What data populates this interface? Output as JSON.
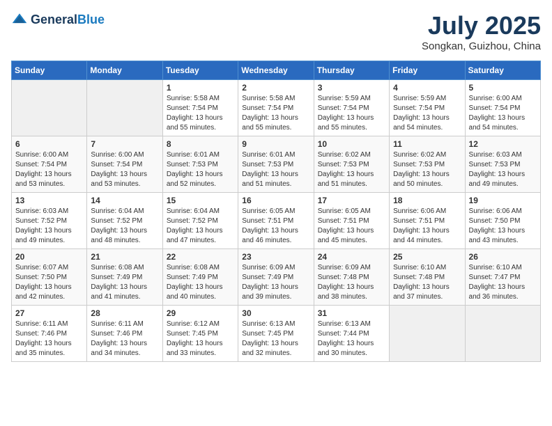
{
  "header": {
    "logo_general": "General",
    "logo_blue": "Blue",
    "month_title": "July 2025",
    "location": "Songkan, Guizhou, China"
  },
  "weekdays": [
    "Sunday",
    "Monday",
    "Tuesday",
    "Wednesday",
    "Thursday",
    "Friday",
    "Saturday"
  ],
  "weeks": [
    [
      {
        "day": "",
        "sunrise": "",
        "sunset": "",
        "daylight": ""
      },
      {
        "day": "",
        "sunrise": "",
        "sunset": "",
        "daylight": ""
      },
      {
        "day": "1",
        "sunrise": "Sunrise: 5:58 AM",
        "sunset": "Sunset: 7:54 PM",
        "daylight": "Daylight: 13 hours and 55 minutes."
      },
      {
        "day": "2",
        "sunrise": "Sunrise: 5:58 AM",
        "sunset": "Sunset: 7:54 PM",
        "daylight": "Daylight: 13 hours and 55 minutes."
      },
      {
        "day": "3",
        "sunrise": "Sunrise: 5:59 AM",
        "sunset": "Sunset: 7:54 PM",
        "daylight": "Daylight: 13 hours and 55 minutes."
      },
      {
        "day": "4",
        "sunrise": "Sunrise: 5:59 AM",
        "sunset": "Sunset: 7:54 PM",
        "daylight": "Daylight: 13 hours and 54 minutes."
      },
      {
        "day": "5",
        "sunrise": "Sunrise: 6:00 AM",
        "sunset": "Sunset: 7:54 PM",
        "daylight": "Daylight: 13 hours and 54 minutes."
      }
    ],
    [
      {
        "day": "6",
        "sunrise": "Sunrise: 6:00 AM",
        "sunset": "Sunset: 7:54 PM",
        "daylight": "Daylight: 13 hours and 53 minutes."
      },
      {
        "day": "7",
        "sunrise": "Sunrise: 6:00 AM",
        "sunset": "Sunset: 7:54 PM",
        "daylight": "Daylight: 13 hours and 53 minutes."
      },
      {
        "day": "8",
        "sunrise": "Sunrise: 6:01 AM",
        "sunset": "Sunset: 7:53 PM",
        "daylight": "Daylight: 13 hours and 52 minutes."
      },
      {
        "day": "9",
        "sunrise": "Sunrise: 6:01 AM",
        "sunset": "Sunset: 7:53 PM",
        "daylight": "Daylight: 13 hours and 51 minutes."
      },
      {
        "day": "10",
        "sunrise": "Sunrise: 6:02 AM",
        "sunset": "Sunset: 7:53 PM",
        "daylight": "Daylight: 13 hours and 51 minutes."
      },
      {
        "day": "11",
        "sunrise": "Sunrise: 6:02 AM",
        "sunset": "Sunset: 7:53 PM",
        "daylight": "Daylight: 13 hours and 50 minutes."
      },
      {
        "day": "12",
        "sunrise": "Sunrise: 6:03 AM",
        "sunset": "Sunset: 7:53 PM",
        "daylight": "Daylight: 13 hours and 49 minutes."
      }
    ],
    [
      {
        "day": "13",
        "sunrise": "Sunrise: 6:03 AM",
        "sunset": "Sunset: 7:52 PM",
        "daylight": "Daylight: 13 hours and 49 minutes."
      },
      {
        "day": "14",
        "sunrise": "Sunrise: 6:04 AM",
        "sunset": "Sunset: 7:52 PM",
        "daylight": "Daylight: 13 hours and 48 minutes."
      },
      {
        "day": "15",
        "sunrise": "Sunrise: 6:04 AM",
        "sunset": "Sunset: 7:52 PM",
        "daylight": "Daylight: 13 hours and 47 minutes."
      },
      {
        "day": "16",
        "sunrise": "Sunrise: 6:05 AM",
        "sunset": "Sunset: 7:51 PM",
        "daylight": "Daylight: 13 hours and 46 minutes."
      },
      {
        "day": "17",
        "sunrise": "Sunrise: 6:05 AM",
        "sunset": "Sunset: 7:51 PM",
        "daylight": "Daylight: 13 hours and 45 minutes."
      },
      {
        "day": "18",
        "sunrise": "Sunrise: 6:06 AM",
        "sunset": "Sunset: 7:51 PM",
        "daylight": "Daylight: 13 hours and 44 minutes."
      },
      {
        "day": "19",
        "sunrise": "Sunrise: 6:06 AM",
        "sunset": "Sunset: 7:50 PM",
        "daylight": "Daylight: 13 hours and 43 minutes."
      }
    ],
    [
      {
        "day": "20",
        "sunrise": "Sunrise: 6:07 AM",
        "sunset": "Sunset: 7:50 PM",
        "daylight": "Daylight: 13 hours and 42 minutes."
      },
      {
        "day": "21",
        "sunrise": "Sunrise: 6:08 AM",
        "sunset": "Sunset: 7:49 PM",
        "daylight": "Daylight: 13 hours and 41 minutes."
      },
      {
        "day": "22",
        "sunrise": "Sunrise: 6:08 AM",
        "sunset": "Sunset: 7:49 PM",
        "daylight": "Daylight: 13 hours and 40 minutes."
      },
      {
        "day": "23",
        "sunrise": "Sunrise: 6:09 AM",
        "sunset": "Sunset: 7:49 PM",
        "daylight": "Daylight: 13 hours and 39 minutes."
      },
      {
        "day": "24",
        "sunrise": "Sunrise: 6:09 AM",
        "sunset": "Sunset: 7:48 PM",
        "daylight": "Daylight: 13 hours and 38 minutes."
      },
      {
        "day": "25",
        "sunrise": "Sunrise: 6:10 AM",
        "sunset": "Sunset: 7:48 PM",
        "daylight": "Daylight: 13 hours and 37 minutes."
      },
      {
        "day": "26",
        "sunrise": "Sunrise: 6:10 AM",
        "sunset": "Sunset: 7:47 PM",
        "daylight": "Daylight: 13 hours and 36 minutes."
      }
    ],
    [
      {
        "day": "27",
        "sunrise": "Sunrise: 6:11 AM",
        "sunset": "Sunset: 7:46 PM",
        "daylight": "Daylight: 13 hours and 35 minutes."
      },
      {
        "day": "28",
        "sunrise": "Sunrise: 6:11 AM",
        "sunset": "Sunset: 7:46 PM",
        "daylight": "Daylight: 13 hours and 34 minutes."
      },
      {
        "day": "29",
        "sunrise": "Sunrise: 6:12 AM",
        "sunset": "Sunset: 7:45 PM",
        "daylight": "Daylight: 13 hours and 33 minutes."
      },
      {
        "day": "30",
        "sunrise": "Sunrise: 6:13 AM",
        "sunset": "Sunset: 7:45 PM",
        "daylight": "Daylight: 13 hours and 32 minutes."
      },
      {
        "day": "31",
        "sunrise": "Sunrise: 6:13 AM",
        "sunset": "Sunset: 7:44 PM",
        "daylight": "Daylight: 13 hours and 30 minutes."
      },
      {
        "day": "",
        "sunrise": "",
        "sunset": "",
        "daylight": ""
      },
      {
        "day": "",
        "sunrise": "",
        "sunset": "",
        "daylight": ""
      }
    ]
  ]
}
